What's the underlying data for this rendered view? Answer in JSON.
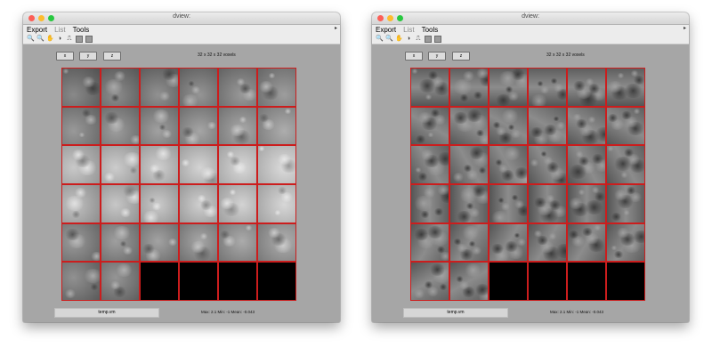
{
  "windows": [
    {
      "title": "dview:",
      "menu": [
        "Export",
        "List",
        "Tools"
      ],
      "buttons": [
        "x",
        "y",
        "z"
      ],
      "voxels": "32 x 32 x 32 voxels",
      "file": "temp.vm",
      "stats": "Max:   2.1  Min:   -1  Mean:  -0.043",
      "tiles_filled": 32,
      "style": "smooth"
    },
    {
      "title": "dview:",
      "menu": [
        "Export",
        "List",
        "Tools"
      ],
      "buttons": [
        "x",
        "y",
        "z"
      ],
      "voxels": "32 x 32 x 32 voxels",
      "file": "temp.vm",
      "stats": "Max:   2.1  Min:   -1  Mean:  -0.043",
      "tiles_filled": 32,
      "style": "blobby"
    }
  ],
  "toolbar_icons": [
    "zoom-in-icon",
    "zoom-out-icon",
    "pan-hand-icon",
    "contrast-icon",
    "pulse-icon",
    "back-icon",
    "forward-icon"
  ],
  "colors": {
    "grid_border": "#cc1d1d",
    "window_bg": "#a6a6a6"
  }
}
